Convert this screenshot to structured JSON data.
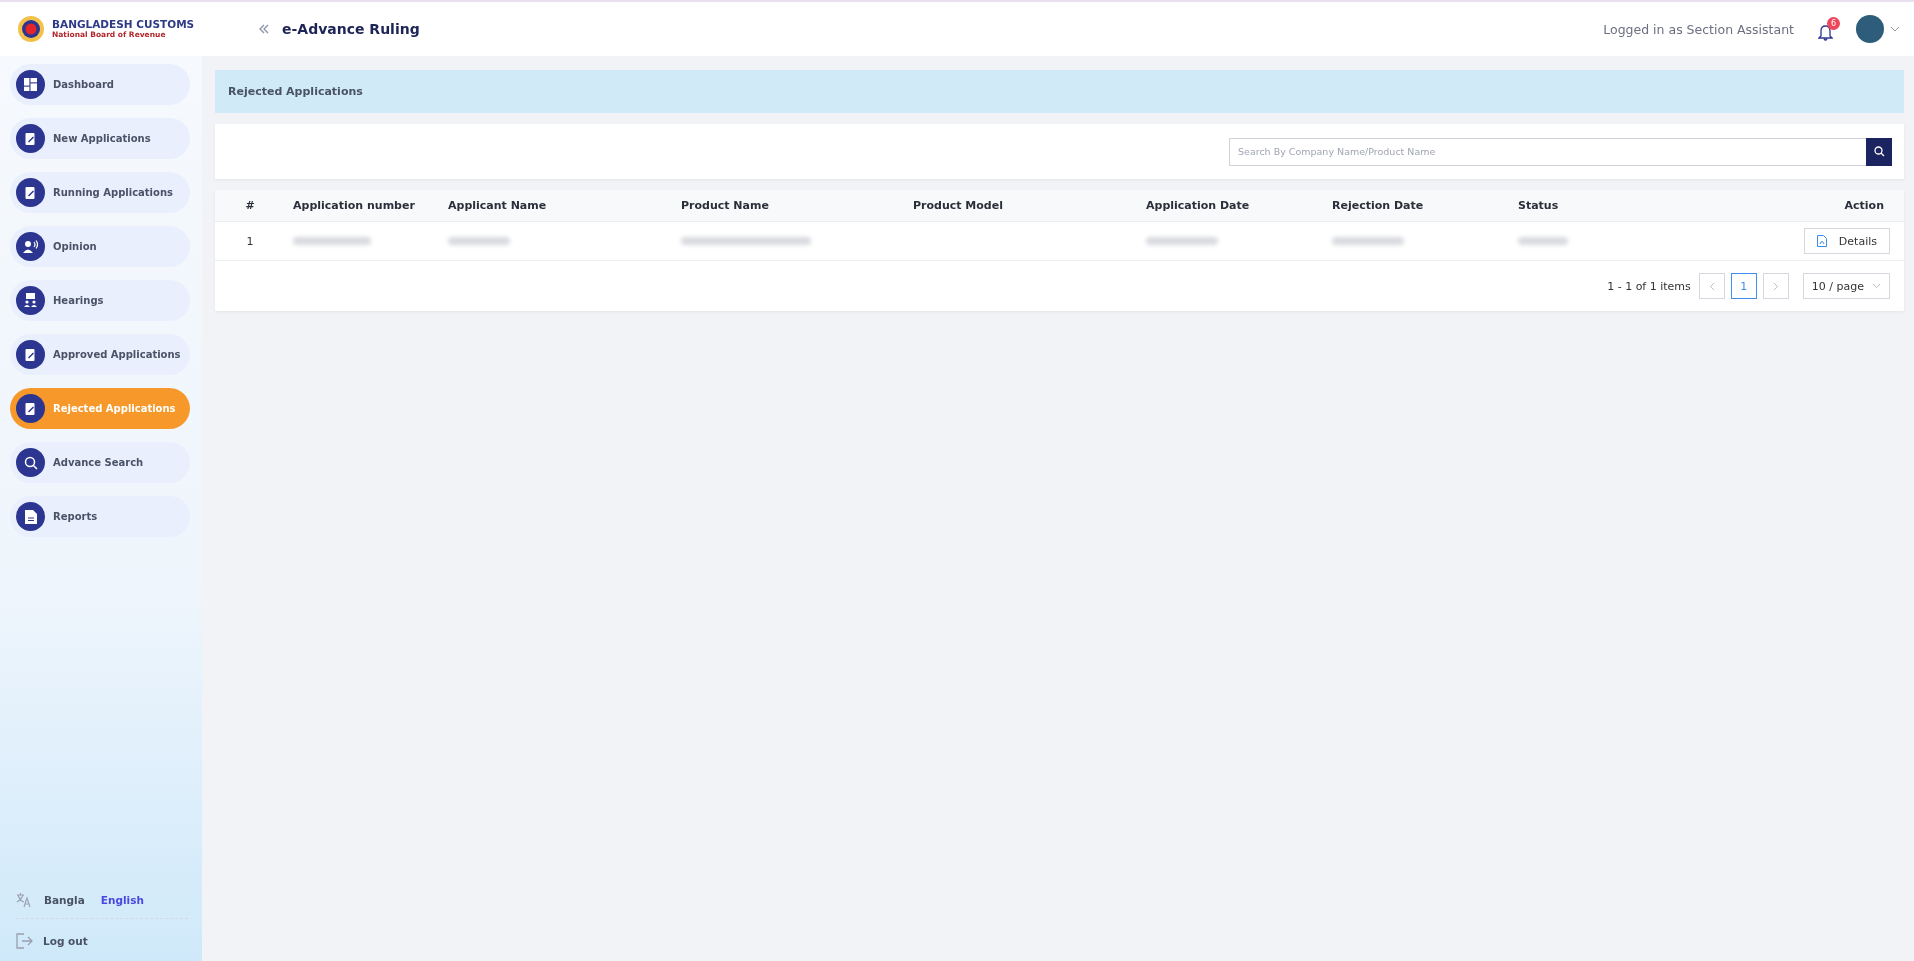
{
  "header": {
    "logo_title": "BANGLADESH CUSTOMS",
    "logo_subtitle": "National Board of Revenue",
    "app_title": "e-Advance Ruling",
    "user_text": "Logged in as Section Assistant",
    "notification_count": "6"
  },
  "sidebar": {
    "items": [
      {
        "label": "Dashboard",
        "kind": "grid",
        "selected": false
      },
      {
        "label": "New Applications",
        "kind": "document",
        "selected": false
      },
      {
        "label": "Running Applications",
        "kind": "document",
        "selected": false
      },
      {
        "label": "Opinion",
        "kind": "speaker",
        "selected": false
      },
      {
        "label": "Hearings",
        "kind": "meeting",
        "selected": false
      },
      {
        "label": "Approved Applications",
        "kind": "document",
        "selected": false
      },
      {
        "label": "Rejected Applications",
        "kind": "document",
        "selected": true
      },
      {
        "label": "Advance Search",
        "kind": "search",
        "selected": false
      },
      {
        "label": "Reports",
        "kind": "report",
        "selected": false
      }
    ],
    "languages": [
      {
        "label": "Bangla",
        "selected": false
      },
      {
        "label": "English",
        "selected": true
      }
    ],
    "logout": "Log out"
  },
  "page": {
    "title": "Rejected Applications",
    "search": {
      "placeholder": "Search By Company Name/Product Name"
    }
  },
  "table": {
    "columns": [
      "#",
      "Application number",
      "Applicant Name",
      "Product Name",
      "Product Model",
      "Application Date",
      "Rejection Date",
      "Status",
      "Action"
    ],
    "rows": [
      {
        "index": "1",
        "action": "Details"
      }
    ]
  },
  "pagination": {
    "summary": "1 - 1 of 1 items",
    "pages": [
      {
        "label": "1",
        "selected": true
      }
    ],
    "page_size": "10 / page"
  }
}
